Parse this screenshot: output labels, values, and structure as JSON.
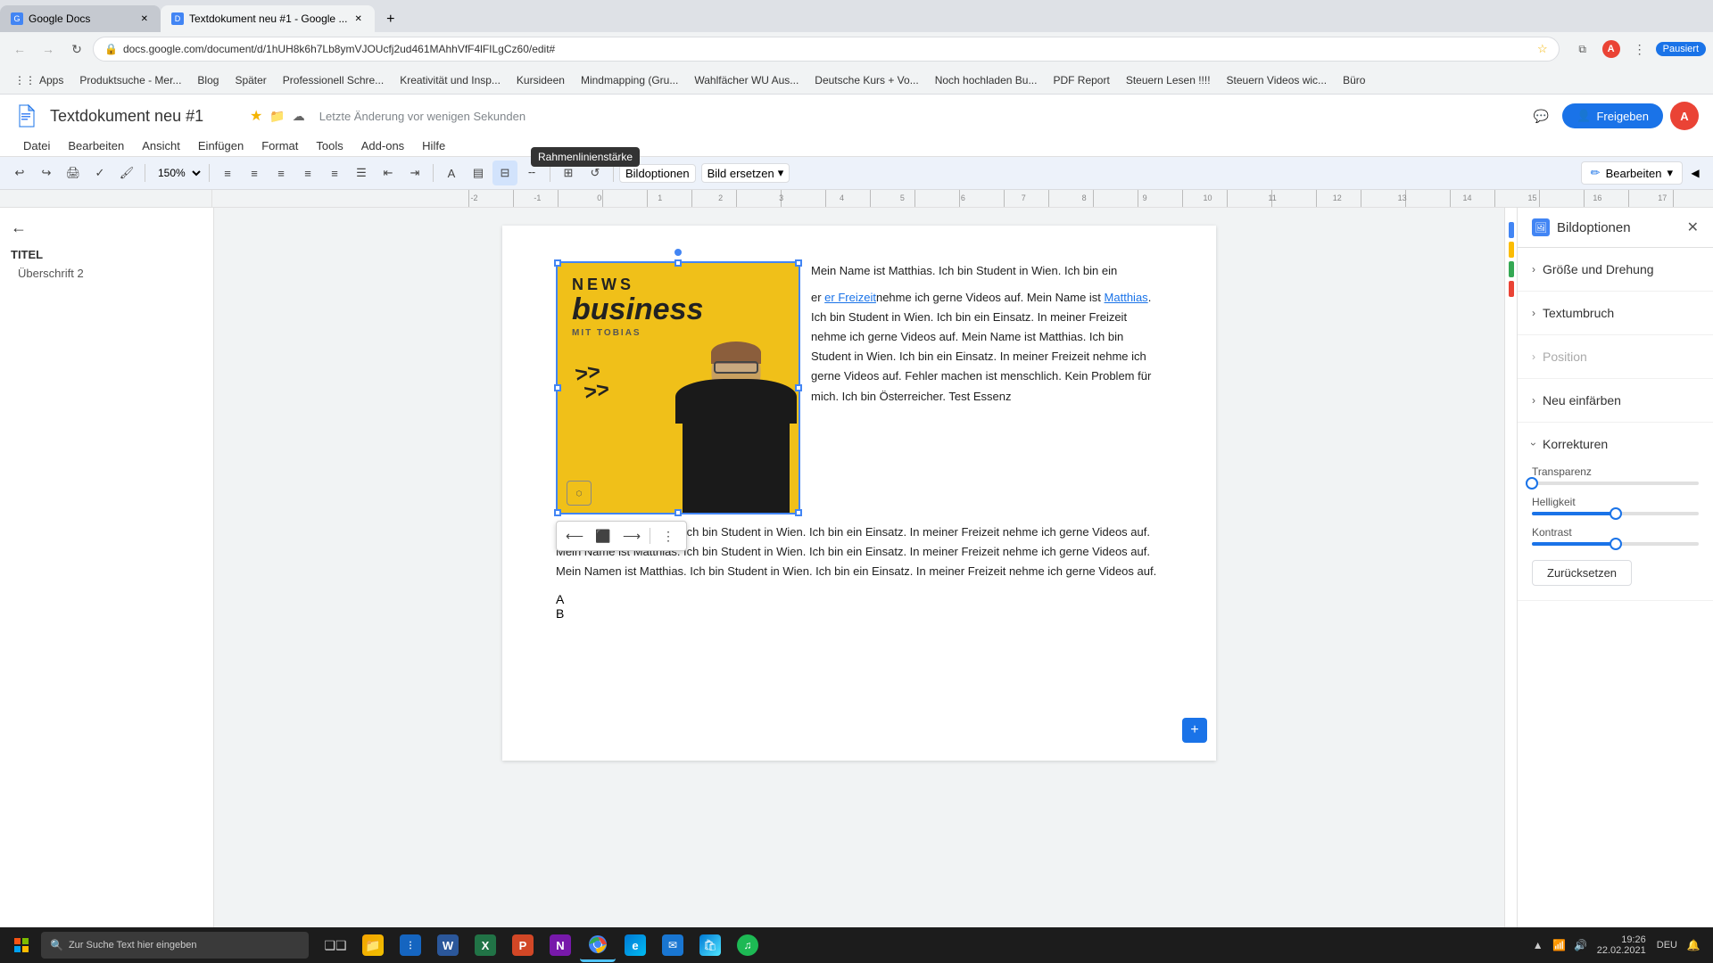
{
  "browser": {
    "tabs": [
      {
        "id": "tab1",
        "title": "Google Docs",
        "favicon": "G",
        "active": false
      },
      {
        "id": "tab2",
        "title": "Textdokument neu #1 - Google ...",
        "favicon": "D",
        "active": true
      }
    ],
    "url": "docs.google.com/document/d/1hUH8k6h7Lb8ymVJOUcfj2ud461MAhhVfF4lFILgCz60/edit#",
    "controls": {
      "back": "←",
      "forward": "→",
      "reload": "↻",
      "home": "⌂"
    }
  },
  "bookmarks": [
    {
      "label": "Apps",
      "icon": "⋮⋮"
    },
    {
      "label": "Produktsuche - Mer...",
      "icon": "P"
    },
    {
      "label": "Blog",
      "icon": "B"
    },
    {
      "label": "Später",
      "icon": "S"
    },
    {
      "label": "Professionell Schre...",
      "icon": "P"
    },
    {
      "label": "Kreativität und Insp...",
      "icon": "K"
    },
    {
      "label": "Kursideen",
      "icon": "K"
    },
    {
      "label": "Mindmapping (Gru...",
      "icon": "M"
    },
    {
      "label": "Wahlfächer WU Aus...",
      "icon": "W"
    },
    {
      "label": "Deutsche Kurs + Vo...",
      "icon": "D"
    },
    {
      "label": "Noch hochladen Bu...",
      "icon": "N"
    },
    {
      "label": "PDF Report",
      "icon": "P"
    },
    {
      "label": "Steuern Lesen !!!!",
      "icon": "S"
    },
    {
      "label": "Steuern Videos wic...",
      "icon": "S"
    },
    {
      "label": "Büro",
      "icon": "B"
    }
  ],
  "header": {
    "title": "Textdokument neu #1",
    "last_saved": "Letzte Änderung vor wenigen Sekunden",
    "menu_items": [
      "Datei",
      "Bearbeiten",
      "Ansicht",
      "Einfügen",
      "Format",
      "Tools",
      "Add-ons",
      "Hilfe"
    ],
    "share_btn": "Freigeben"
  },
  "toolbar": {
    "zoom_level": "150%",
    "image_btn": "Bildoptionen",
    "replace_btn": "Bild ersetzen",
    "bearbeiten_btn": "Bearbeiten",
    "tooltip_text": "Rahmenlinienstärke"
  },
  "outline": {
    "back_label": "←",
    "title_item": "TITEL",
    "items": [
      "Überschrift 2"
    ]
  },
  "document": {
    "image_tag": "NEWS",
    "image_business": "business",
    "image_mit": "MIT TOBIAS",
    "text_intro": "Mein Name ist Matthias. Ich bin Student in Wien. Ich bin ein",
    "text_link1": "er Freizeit",
    "text_link2": "nehme ich gerne Videos auf. Mein Name ist",
    "text_link3": "Matthias",
    "text_p1": ". Ich bin Student in Wien. Ich bin ein Einsatz. In meiner Freizeit nehme ich gerne Videos auf. Mein Name ist Matthias. Ich bin Student in Wien. Ich bin ein Einsatz. In meiner Freizeit nehme ich gerne Videos auf. Fehler machen ist menschlich. Kein Problem für mich. Ich bin Österreicher. Test Essenz",
    "text_p2": "Mein Name ist Matthias. Ich bin Student in Wien. Ich bin ein Einsatz. In meiner Freizeit nehme ich gerne Videos auf. Mein Name ist Matthias. Ich bin Student in Wien. Ich bin ein Einsatz. In meiner Freizeit nehme ich gerne Videos auf. Mein Namen ist Matthias. Ich bin Student in Wien. Ich bin ein Einsatz. In meiner Freizeit nehme ich gerne Videos auf.",
    "list_a": "A",
    "list_b": "B"
  },
  "right_panel": {
    "title": "Bildoptionen",
    "close_btn": "✕",
    "sections": [
      {
        "label": "Größe und Drehung",
        "expanded": false,
        "disabled": false
      },
      {
        "label": "Textumbruch",
        "expanded": false,
        "disabled": false
      },
      {
        "label": "Position",
        "expanded": false,
        "disabled": true
      },
      {
        "label": "Neu einfärben",
        "expanded": false,
        "disabled": false
      },
      {
        "label": "Korrekturen",
        "expanded": true,
        "disabled": false
      }
    ],
    "korrekturen": {
      "transparenz_label": "Transparenz",
      "transparenz_value": 0,
      "helligkeit_label": "Helligkeit",
      "helligkeit_value": 50,
      "kontrast_label": "Kontrast",
      "kontrast_value": 50,
      "reset_btn": "Zurücksetzen"
    }
  },
  "taskbar": {
    "search_placeholder": "Zur Suche Text hier eingeben",
    "time": "19:26",
    "date": "22.02.2021",
    "language": "DEU",
    "apps": [
      {
        "name": "windows",
        "icon": "⊞"
      },
      {
        "name": "explorer",
        "icon": "📁"
      },
      {
        "name": "task-manager",
        "icon": "≡"
      },
      {
        "name": "word",
        "icon": "W"
      },
      {
        "name": "excel",
        "icon": "X"
      },
      {
        "name": "powerpoint",
        "icon": "P"
      },
      {
        "name": "onenote",
        "icon": "N"
      },
      {
        "name": "chrome",
        "icon": "●"
      },
      {
        "name": "edge",
        "icon": "e"
      },
      {
        "name": "mail",
        "icon": "✉"
      },
      {
        "name": "store",
        "icon": "🛍"
      },
      {
        "name": "spotify",
        "icon": "♫"
      }
    ]
  }
}
